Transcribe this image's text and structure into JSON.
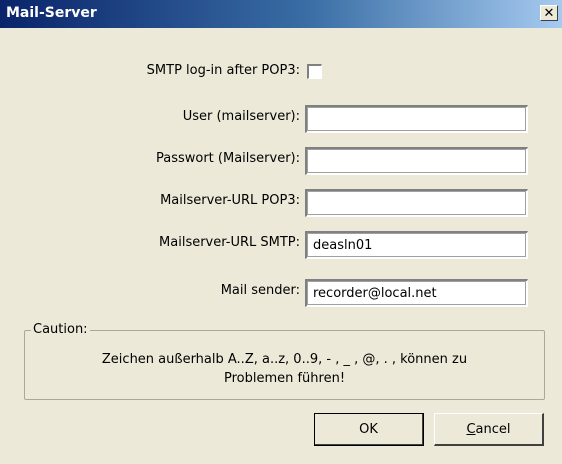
{
  "window": {
    "title": "Mail-Server",
    "close_glyph": "✕",
    "close_icon": "close-icon"
  },
  "form": {
    "smtp_login_label": "SMTP log-in after POP3:",
    "smtp_login_checked": false,
    "user_label": "User (mailserver):",
    "user_value": "",
    "password_label": "Passwort (Mailserver):",
    "password_value": "",
    "pop3_url_label": "Mailserver-URL POP3:",
    "pop3_url_value": "",
    "smtp_url_label": "Mailserver-URL SMTP:",
    "smtp_url_value": "deasln01",
    "sender_label": "Mail sender:",
    "sender_value": "recorder@local.net"
  },
  "caution": {
    "title": "Caution:",
    "line1": "Zeichen außerhalb A..Z, a..z, 0..9, - , _ , @, . , können zu",
    "line2": "Problemen führen!"
  },
  "buttons": {
    "ok": "OK",
    "cancel_first": "C",
    "cancel_rest": "ancel"
  }
}
